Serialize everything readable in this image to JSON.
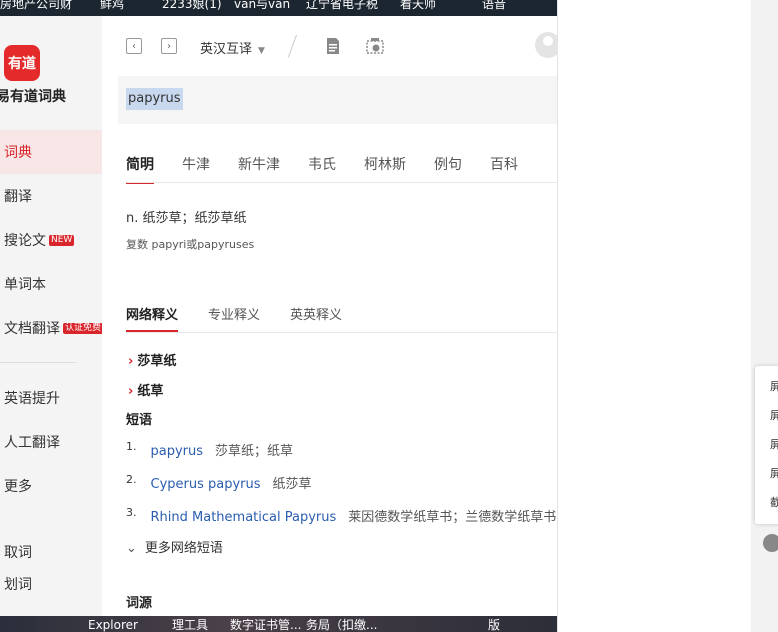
{
  "taskbar_top": [
    "房地产公司财",
    "鲜鸡",
    "2233娘(1)",
    "van与van",
    "辽宁省电子税",
    "看天师",
    "语音"
  ],
  "taskbar_bottom": [
    "Explorer",
    "理工具",
    "数字证书管...",
    "务局（扣缴...",
    "版"
  ],
  "sidebar": {
    "logo_text": "有道",
    "app_title": "易有道词典",
    "items": [
      {
        "label": "词典"
      },
      {
        "label": "翻译"
      },
      {
        "label": "搜论文",
        "badge": "NEW"
      },
      {
        "label": "单词本"
      },
      {
        "label": "文档翻译",
        "badge": "认证免费"
      },
      {
        "label": "英语提升"
      },
      {
        "label": "人工翻译"
      },
      {
        "label": "更多"
      },
      {
        "label": "取词"
      },
      {
        "label": "划词"
      }
    ]
  },
  "toolbar": {
    "back_icon": "chevron-left-icon",
    "forward_icon": "chevron-right-icon",
    "lang_mode": "英汉互译",
    "doc_icon": "document-icon",
    "screenshot_icon": "camera-icon"
  },
  "search": {
    "query": "papyrus"
  },
  "dict_tabs": [
    "简明",
    "牛津",
    "新牛津",
    "韦氏",
    "柯林斯",
    "例句",
    "百科"
  ],
  "definition": {
    "line": "n. 纸莎草；纸莎草纸",
    "plural": "复数 papyri或papyruses"
  },
  "web_tabs": [
    "网络释义",
    "专业释义",
    "英英释义"
  ],
  "senses": [
    "莎草纸",
    "纸草"
  ],
  "phrases_title": "短语",
  "phrases": [
    {
      "num": "1.",
      "en": "papyrus",
      "zh": "莎草纸；纸草"
    },
    {
      "num": "2.",
      "en": "Cyperus papyrus",
      "zh": "纸莎草"
    },
    {
      "num": "3.",
      "en": "Rhind Mathematical Papyrus",
      "zh": "莱因德数学纸草书；兰德数学纸草书"
    }
  ],
  "more_phrases": "更多网络短语",
  "etymology_title": "词源",
  "popup_items": [
    "屏",
    "屏",
    "屏",
    "屏",
    "截"
  ],
  "colors": {
    "accent": "#d8262c",
    "link": "#2a5db0",
    "sidebar_bg": "#f4f4f4"
  }
}
